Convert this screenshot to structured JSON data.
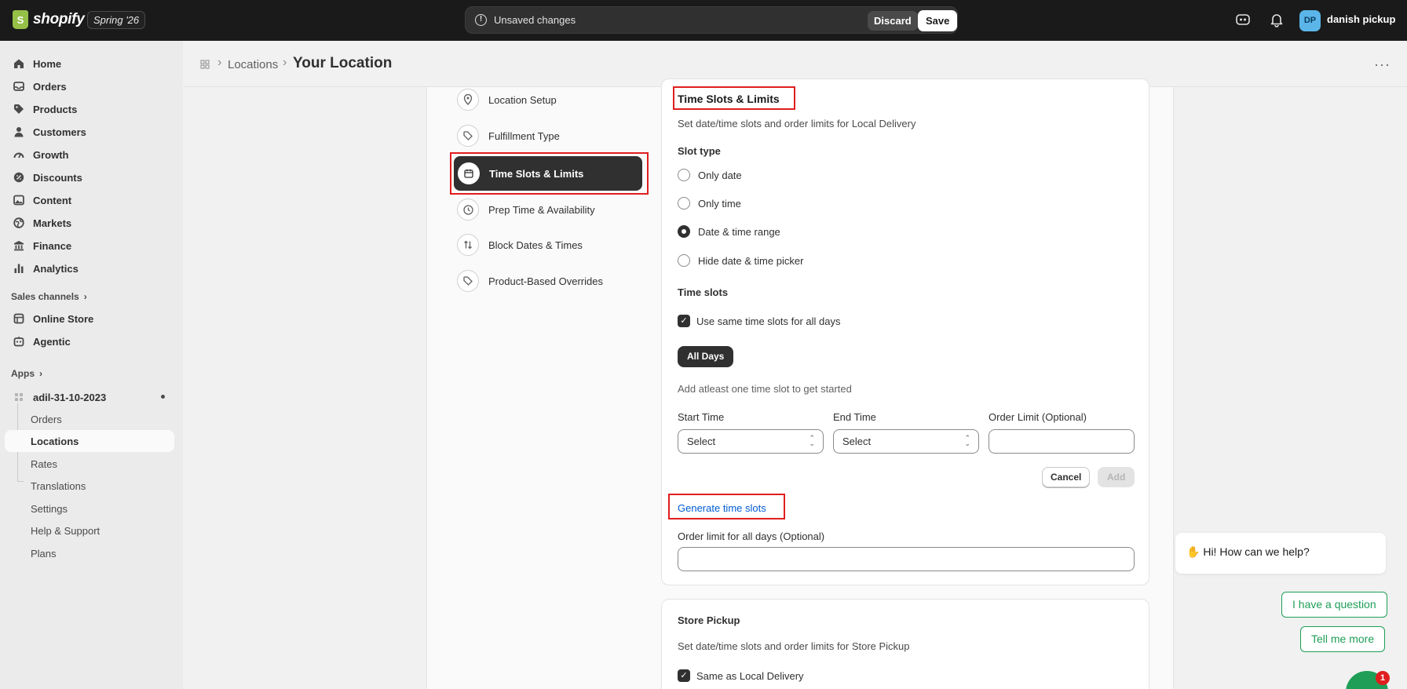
{
  "topbar": {
    "brand": "shopify",
    "edition": "Spring '26",
    "unsaved_text": "Unsaved changes",
    "discard_label": "Discard",
    "save_label": "Save",
    "avatar_initials": "DP",
    "store_name": "danish pickup"
  },
  "nav": {
    "items": [
      {
        "label": "Home",
        "icon": "home-icon"
      },
      {
        "label": "Orders",
        "icon": "inbox-icon"
      },
      {
        "label": "Products",
        "icon": "tag-icon"
      },
      {
        "label": "Customers",
        "icon": "person-icon"
      },
      {
        "label": "Growth",
        "icon": "gauge-icon"
      },
      {
        "label": "Discounts",
        "icon": "discount-icon"
      },
      {
        "label": "Content",
        "icon": "image-icon"
      },
      {
        "label": "Markets",
        "icon": "globe-icon"
      },
      {
        "label": "Finance",
        "icon": "bank-icon"
      },
      {
        "label": "Analytics",
        "icon": "bar-chart-icon"
      }
    ],
    "sales_channels_label": "Sales channels",
    "channels": [
      {
        "label": "Online Store",
        "icon": "store-icon"
      },
      {
        "label": "Agentic",
        "icon": "robot-icon"
      }
    ],
    "apps_label": "Apps",
    "app_name": "adil-31-10-2023",
    "app_sub": [
      "Orders",
      "Locations",
      "Rates",
      "Translations",
      "Settings",
      "Help & Support",
      "Plans"
    ]
  },
  "header": {
    "breadcrumb_parent": "Locations",
    "title": "Your Location"
  },
  "steps": [
    {
      "label": "Location Setup",
      "icon": "map-pin-icon"
    },
    {
      "label": "Fulfillment Type",
      "icon": "tag-icon"
    },
    {
      "label": "Time Slots & Limits",
      "icon": "calendar-icon"
    },
    {
      "label": "Prep Time & Availability",
      "icon": "clock-icon"
    },
    {
      "label": "Block Dates & Times",
      "icon": "arrows-icon"
    },
    {
      "label": "Product-Based Overrides",
      "icon": "tag-icon"
    }
  ],
  "local_delivery": {
    "title": "Time Slots & Limits",
    "description": "Set date/time slots and order limits for Local Delivery",
    "slot_type_label": "Slot type",
    "slot_options": [
      "Only date",
      "Only time",
      "Date & time range",
      "Hide date & time picker"
    ],
    "selected_slot_option": "Date & time range",
    "time_slots_label": "Time slots",
    "same_slots_label": "Use same time slots for all days",
    "same_slots_checked": true,
    "day_tab": "All Days",
    "empty_hint": "Add atleast one time slot to get started",
    "start_time_label": "Start Time",
    "end_time_label": "End Time",
    "order_limit_label": "Order Limit (Optional)",
    "start_time_value": "Select",
    "end_time_value": "Select",
    "order_limit_value": "",
    "cancel_label": "Cancel",
    "add_label": "Add",
    "generate_link": "Generate time slots",
    "order_limit_all_label": "Order limit for all days (Optional)",
    "order_limit_all_value": ""
  },
  "store_pickup": {
    "title": "Store Pickup",
    "description": "Set date/time slots and order limits for Store Pickup",
    "same_as_label": "Same as Local Delivery",
    "same_as_checked": true
  },
  "chat": {
    "greeting": "Hi! How can we help?",
    "option_1": "I have a question",
    "option_2": "Tell me more",
    "badge_count": "1",
    "color": "#1e9e57"
  },
  "colors": {
    "highlight": "#e01e1e",
    "link": "#005bd3",
    "topbar": "#1a1a1a"
  }
}
